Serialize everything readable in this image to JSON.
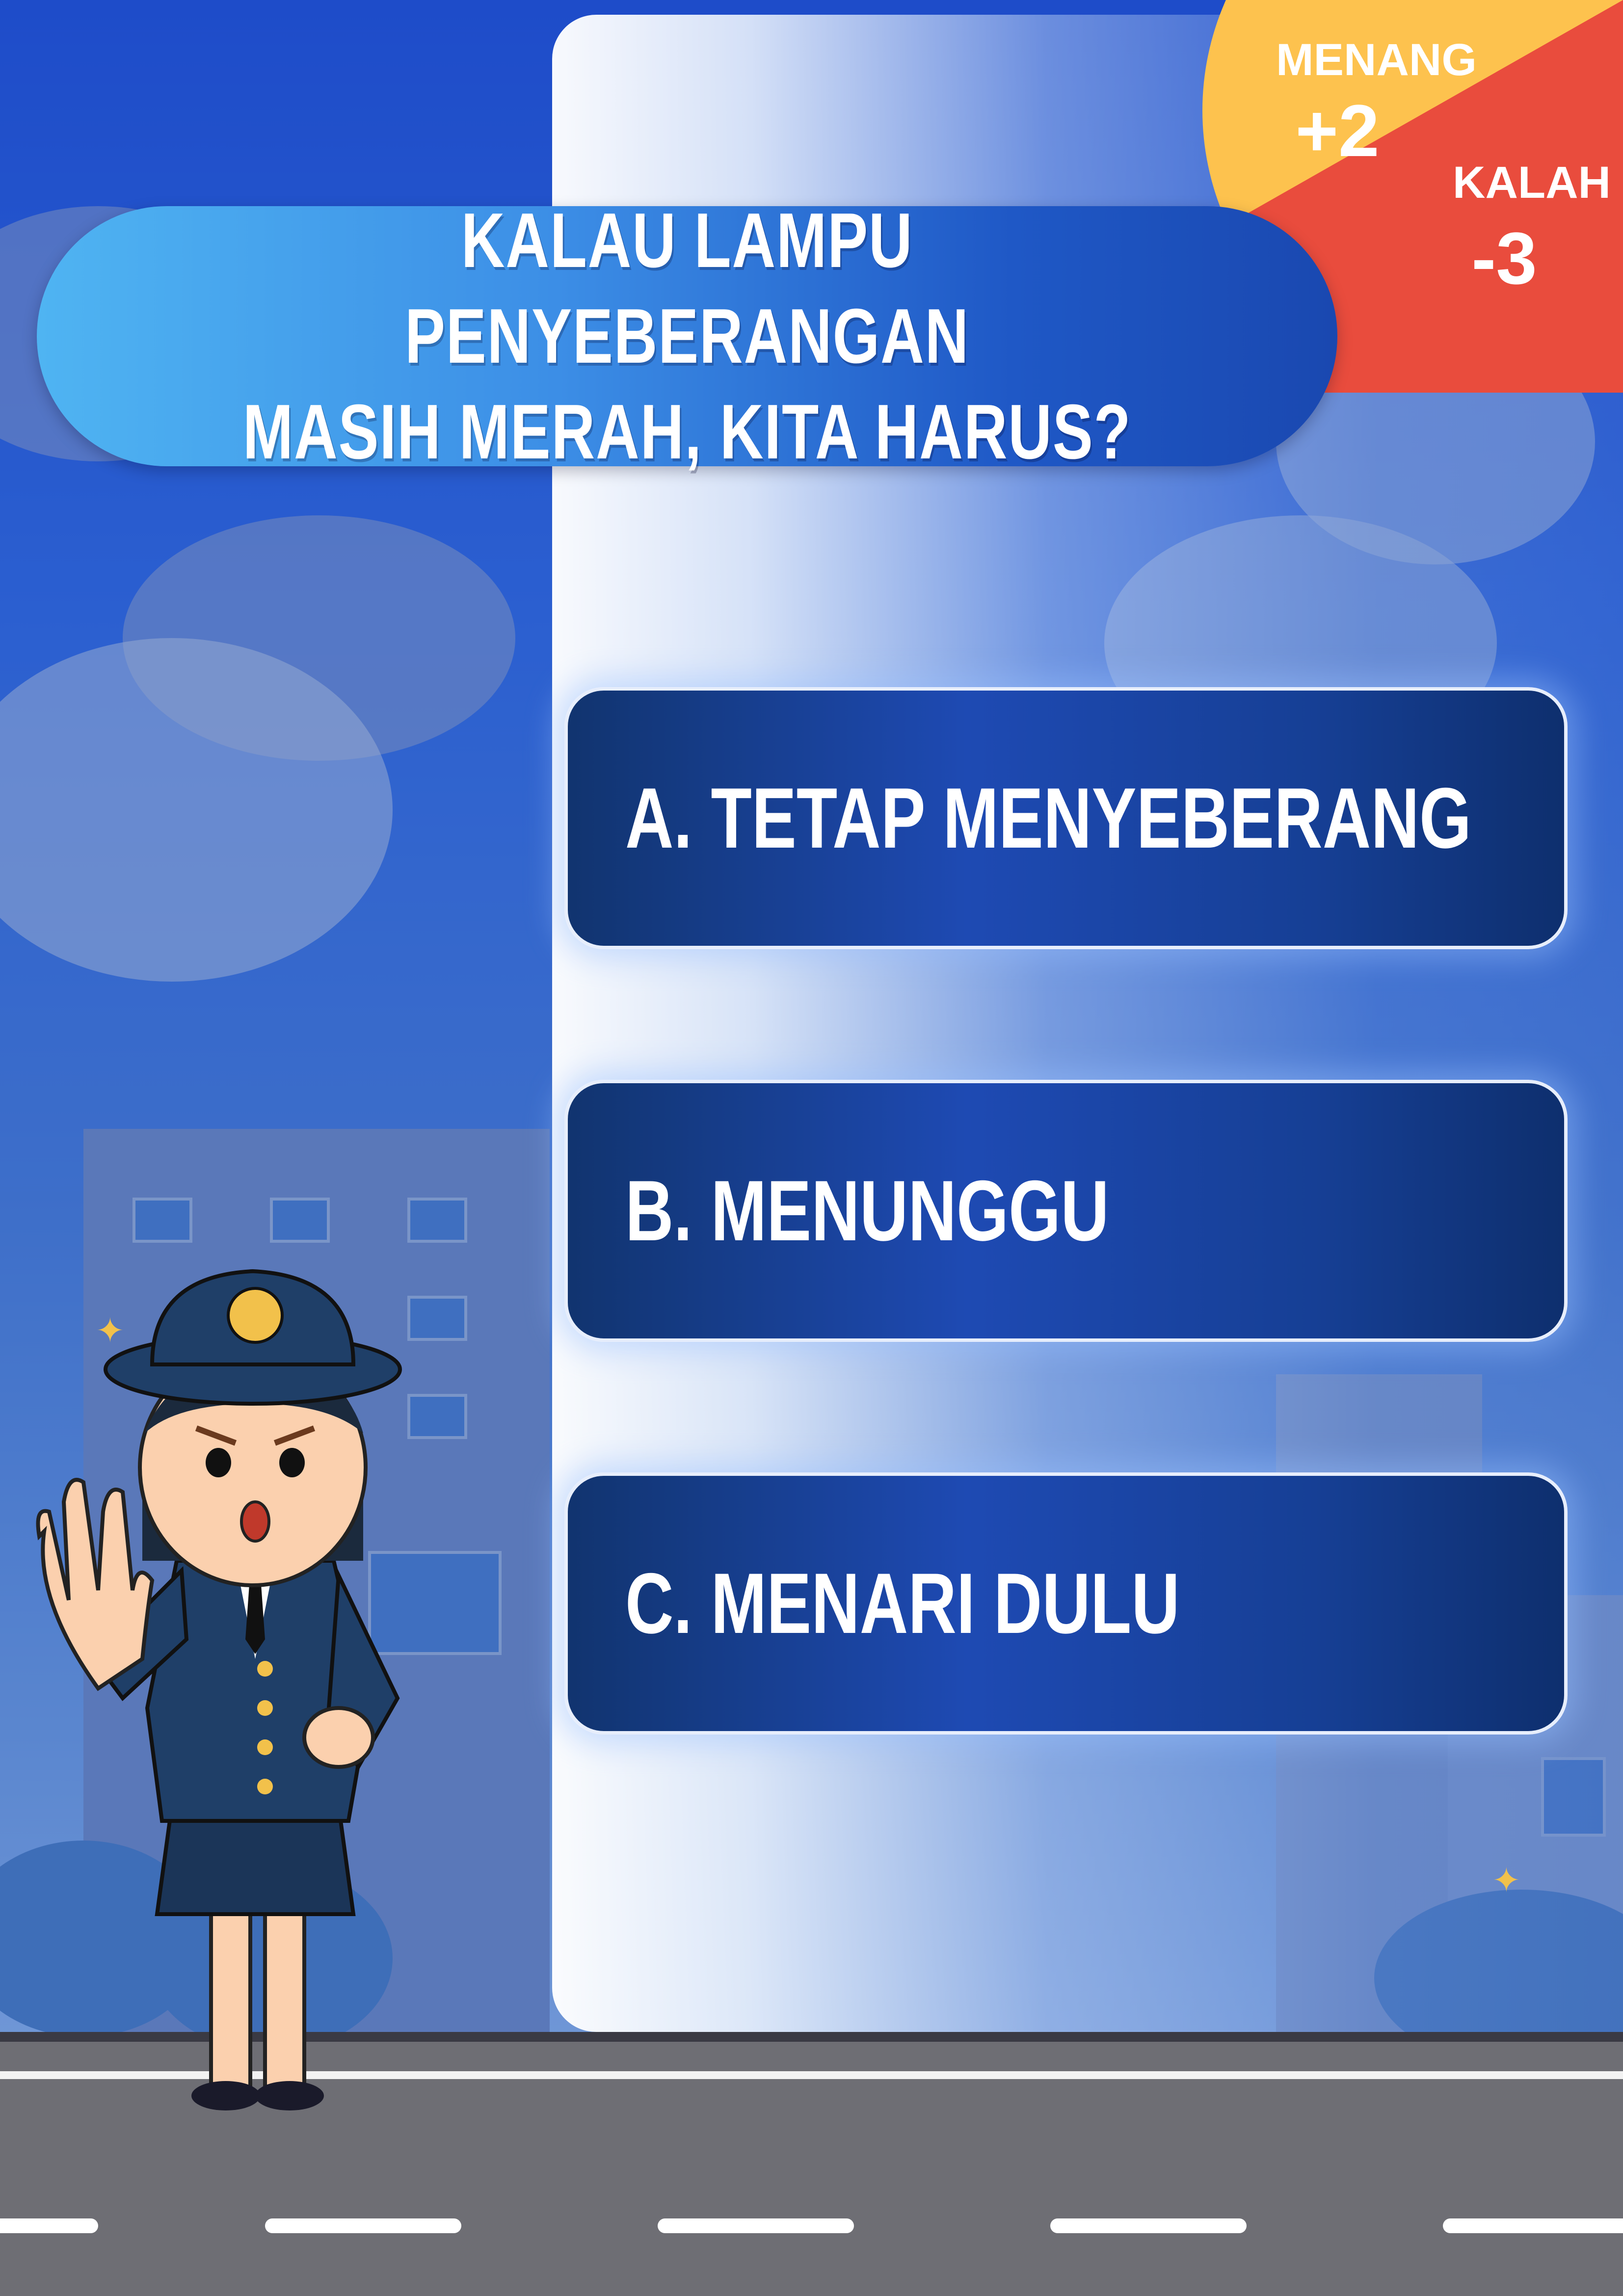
{
  "question": {
    "line1": "KALAU LAMPU PENYEBERANGAN",
    "line2": "MASIH MERAH, KITA HARUS?"
  },
  "score": {
    "win_label": "MENANG",
    "win_value": "+2",
    "lose_label": "KALAH",
    "lose_value": "-3"
  },
  "answers": [
    {
      "label": "A. TETAP MENYEBERANG"
    },
    {
      "label": "B. MENUNGGU"
    },
    {
      "label": "C. MENARI DULU"
    }
  ],
  "colors": {
    "background": "#1e4cc9",
    "win": "#fdc24e",
    "lose": "#e94c3d",
    "answer": "#163f95",
    "road": "#6e6e74"
  },
  "icons": {
    "character": "traffic-officer-illustration",
    "sparkle": "sparkle-icon"
  }
}
